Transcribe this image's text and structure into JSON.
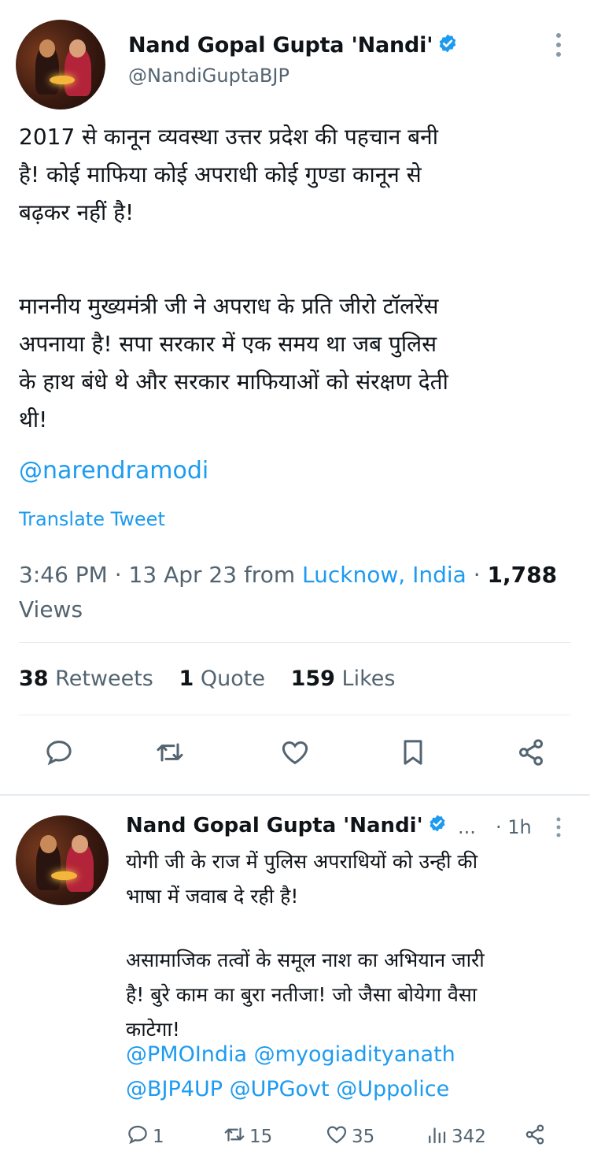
{
  "main_tweet": {
    "author_name": "Nand Gopal Gupta 'Nandi'",
    "author_handle": "@NandiGuptaBJP",
    "more_icon": "more-vertical-icon",
    "paragraph1_lines": [
      "2017 से कानून व्यवस्था उत्तर प्रदेश की पहचान बनी",
      "है!  कोई माफिया कोई अपराधी कोई गुण्डा कानून से",
      "बढ़कर नहीं है!"
    ],
    "paragraph2_lines": [
      "माननीय मुख्यमंत्री जी ने अपराध के प्रति जीरो टॉलरेंस",
      "अपनाया है! सपा सरकार में एक समय था जब पुलिस",
      "के हाथ बंधे थे और सरकार माफियाओं को संरक्षण देती",
      "थी!"
    ],
    "mention": "@narendramodi",
    "translate_label": "Translate Tweet",
    "time": "3:46 PM",
    "date": "13 Apr 23",
    "from_label": "from",
    "location": "Lucknow, India",
    "views_count": "1,788",
    "views_label": "Views",
    "retweets_count": "38",
    "retweets_label": "Retweets",
    "quotes_count": "1",
    "quotes_label": "Quote",
    "likes_count": "159",
    "likes_label": "Likes"
  },
  "reply_tweet": {
    "author_name": "Nand Gopal Gupta 'Nandi'",
    "ellipsis": "...",
    "time": "· 1h",
    "paragraph1_lines": [
      "योगी जी के राज में पुलिस अपराधियों को उन्ही की",
      "भाषा में जवाब दे रही है!"
    ],
    "paragraph2_lines": [
      "असामाजिक तत्वों के समूल नाश का अभियान जारी",
      "है! बुरे काम का बुरा नतीजा! जो जैसा बोयेगा वैसा",
      "काटेगा!"
    ],
    "mentions_line1": "@PMOIndia @myogiadityanath",
    "mentions_line2": "@BJP4UP @UPGovt @Uppolice",
    "reply_count": "1",
    "retweet_count": "15",
    "like_count": "35",
    "views_count": "342"
  },
  "colors": {
    "accent": "#1d9bf0",
    "text": "#0f1419",
    "secondary": "#536471",
    "divider": "#e6ecf0"
  }
}
